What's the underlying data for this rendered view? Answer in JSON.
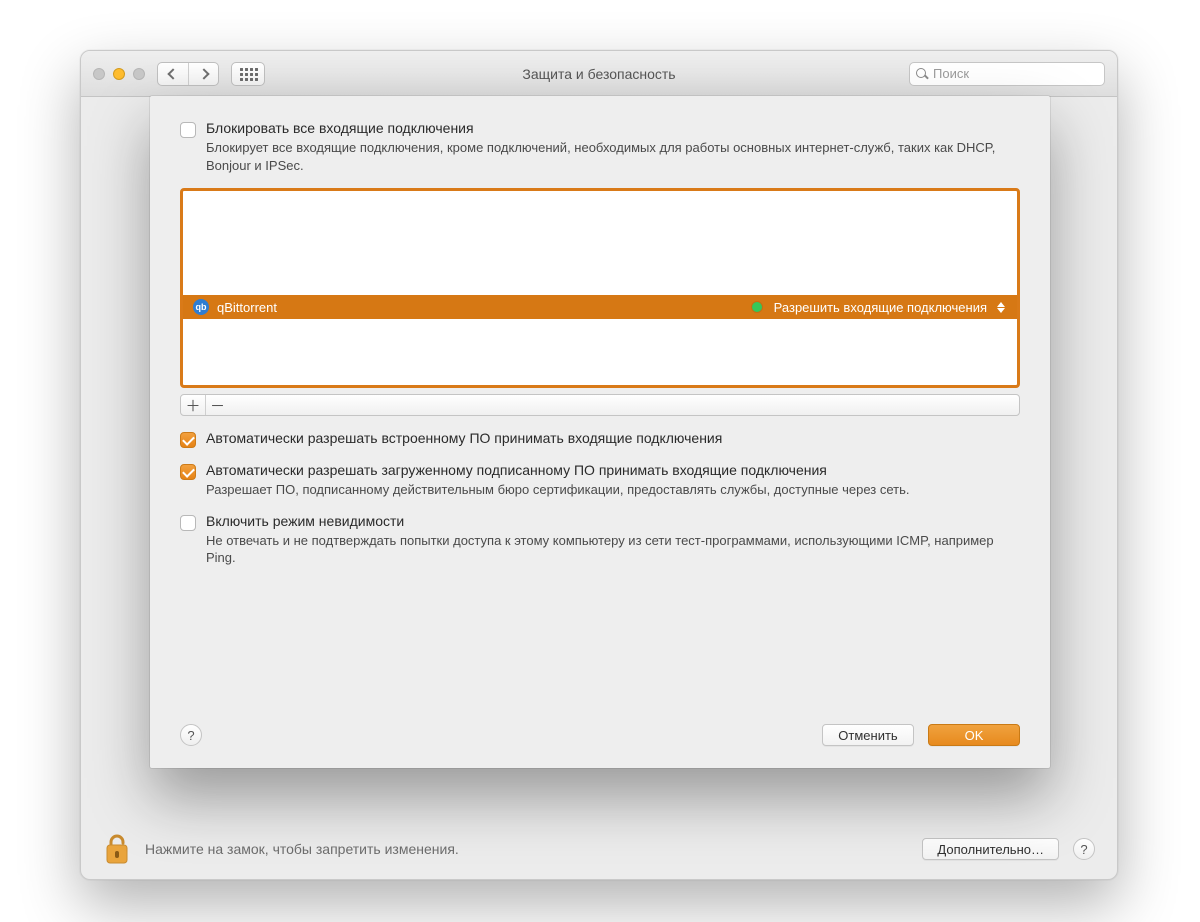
{
  "window": {
    "title": "Защита и безопасность",
    "search_placeholder": "Поиск"
  },
  "sheet": {
    "block_all": {
      "label": "Блокировать все входящие подключения",
      "description": "Блокирует все входящие подключения, кроме подключений, необходимых для работы основных интернет-служб, таких как DHCP, Bonjour и IPSec.",
      "checked": false
    },
    "app_list": {
      "selected": {
        "name": "qBittorrent",
        "icon_text": "qb",
        "status": "Разрешить входящие подключения"
      }
    },
    "auto_builtin": {
      "label": "Автоматически разрешать встроенному ПО принимать входящие подключения",
      "checked": true
    },
    "auto_signed": {
      "label": "Автоматически разрешать загруженному подписанному ПО принимать входящие подключения",
      "description": "Разрешает ПО, подписанному действительным бюро сертификации, предоставлять службы, доступные через сеть.",
      "checked": true
    },
    "stealth": {
      "label": "Включить режим невидимости",
      "description": "Не отвечать и не подтверждать попытки доступа к этому компьютеру из сети тест-программами, использующими ICMP, например Ping.",
      "checked": false
    },
    "buttons": {
      "cancel": "Отменить",
      "ok": "OK"
    }
  },
  "footer": {
    "lock_text": "Нажмите на замок, чтобы запретить изменения.",
    "advanced": "Дополнительно…"
  },
  "glyphs": {
    "plus": "＋",
    "minus": "－",
    "help": "?"
  }
}
